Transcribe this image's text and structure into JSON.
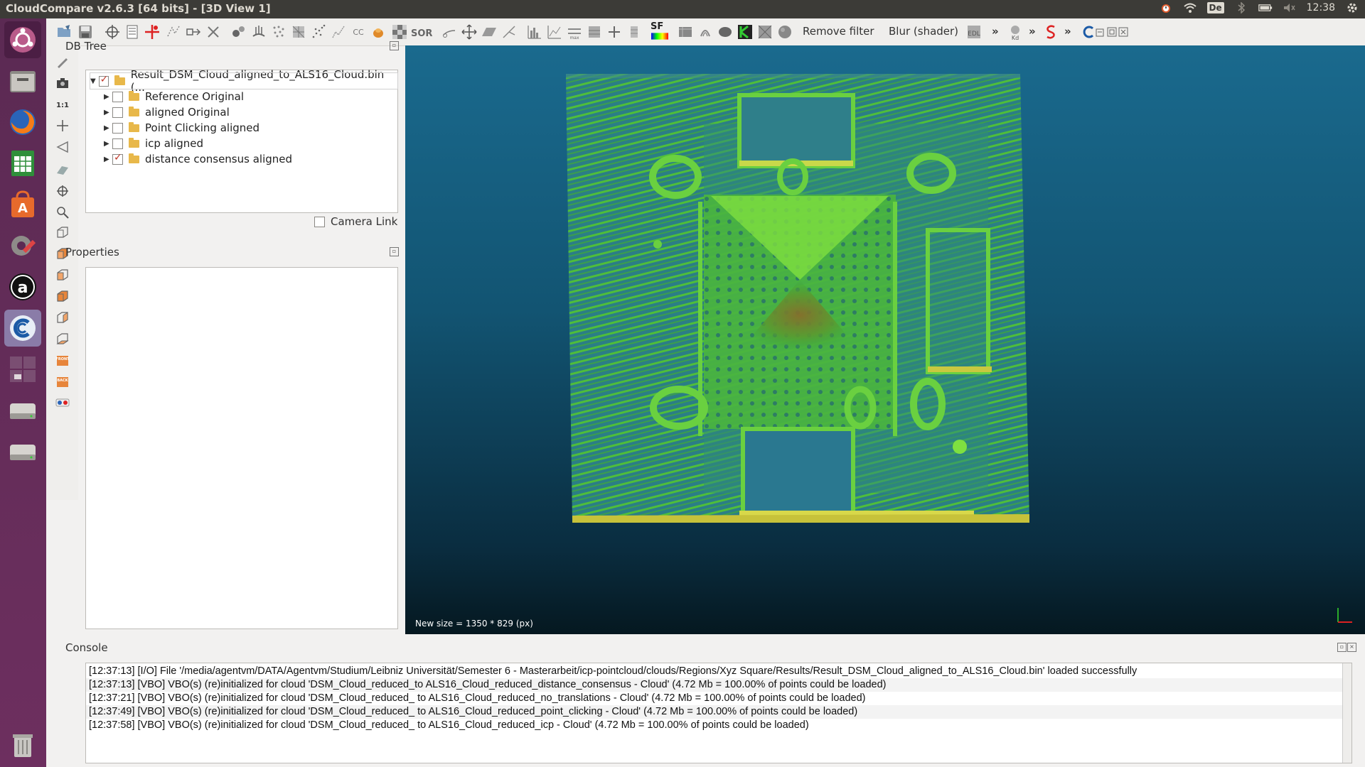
{
  "window": {
    "title": "CloudCompare v2.6.3 [64 bits] - [3D View 1]"
  },
  "system_tray": {
    "keyboard": "De",
    "time": "12:38"
  },
  "launcher": {
    "items": [
      "ubuntu-dash-icon",
      "file-manager-icon",
      "firefox-icon",
      "spreadsheet-icon",
      "software-center-icon",
      "system-settings-icon",
      "amazon-icon",
      "cloudcompare-icon",
      "workspace-switcher-icon",
      "disk-icon",
      "disk-icon-2",
      "trash-icon"
    ]
  },
  "toolbar": {
    "remove_filter": "Remove filter",
    "blur_shader": "Blur (shader)",
    "sor_label": "SOR",
    "sf_label": "SF",
    "more_1": "»",
    "more_2": "»",
    "more_3": "»"
  },
  "db_tree": {
    "title": "DB Tree",
    "root": {
      "label": "Result_DSM_Cloud_aligned_to_ALS16_Cloud.bin (...",
      "checked": true
    },
    "children": [
      {
        "label": "Reference Original",
        "checked": false
      },
      {
        "label": "aligned Original",
        "checked": false
      },
      {
        "label": "Point Clicking aligned",
        "checked": false
      },
      {
        "label": "icp aligned",
        "checked": false
      },
      {
        "label": "distance consensus aligned",
        "checked": true
      }
    ],
    "camera_link": "Camera Link"
  },
  "properties": {
    "title": "Properties"
  },
  "view3d": {
    "caption": "New size = 1350 * 829 (px)"
  },
  "console": {
    "title": "Console",
    "lines": [
      "[12:37:13] [I/O] File '/media/agentvm/DATA/Agentvm/Studium/Leibniz Universität/Semester 6 - Masterarbeit/icp-pointcloud/clouds/Regions/Xyz Square/Results/Result_DSM_Cloud_aligned_to_ALS16_Cloud.bin' loaded successfully",
      "[12:37:13] [VBO] VBO(s) (re)initialized for cloud 'DSM_Cloud_reduced_to ALS16_Cloud_reduced_distance_consensus - Cloud' (4.72 Mb = 100.00% of points could be loaded)",
      "[12:37:21] [VBO] VBO(s) (re)initialized for cloud 'DSM_Cloud_reduced_ to ALS16_Cloud_reduced_no_translations - Cloud' (4.72 Mb = 100.00% of points could be loaded)",
      "[12:37:49] [VBO] VBO(s) (re)initialized for cloud 'DSM_Cloud_reduced_ to ALS16_Cloud_reduced_point_clicking - Cloud' (4.72 Mb = 100.00% of points could be loaded)",
      "[12:37:58] [VBO] VBO(s) (re)initialized for cloud 'DSM_Cloud_reduced_ to ALS16_Cloud_reduced_icp - Cloud' (4.72 Mb = 100.00% of points could be loaded)"
    ]
  }
}
